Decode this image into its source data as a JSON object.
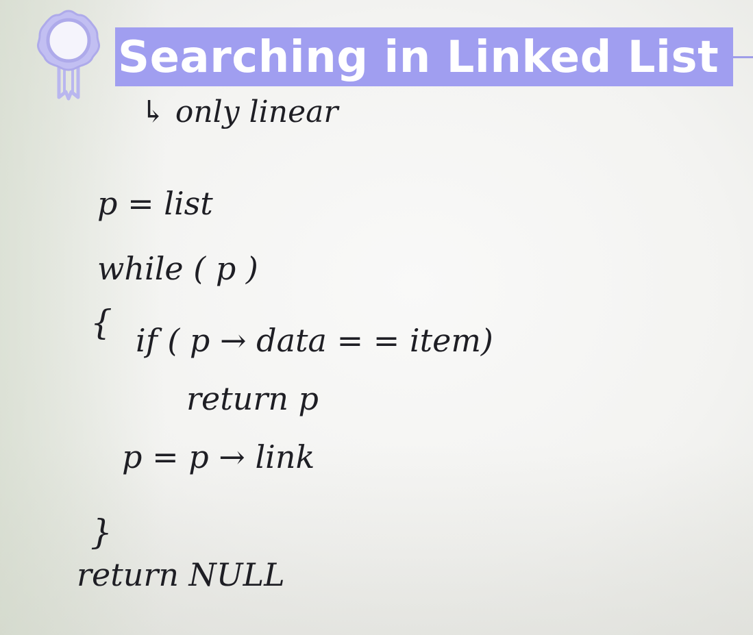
{
  "slide": {
    "title": "Searching in Linked List",
    "badge_icon": "award-ribbon-icon",
    "colors": {
      "title_band": "#a09ef0",
      "title_text": "#ffffff",
      "ink": "#1e1e24"
    }
  },
  "handwriting": {
    "note": "↳ only linear",
    "code": [
      "p = list",
      "while ( p )",
      "{",
      "if ( p → data = = item)",
      "return p",
      "p = p → link",
      "}",
      "return NULL"
    ]
  }
}
